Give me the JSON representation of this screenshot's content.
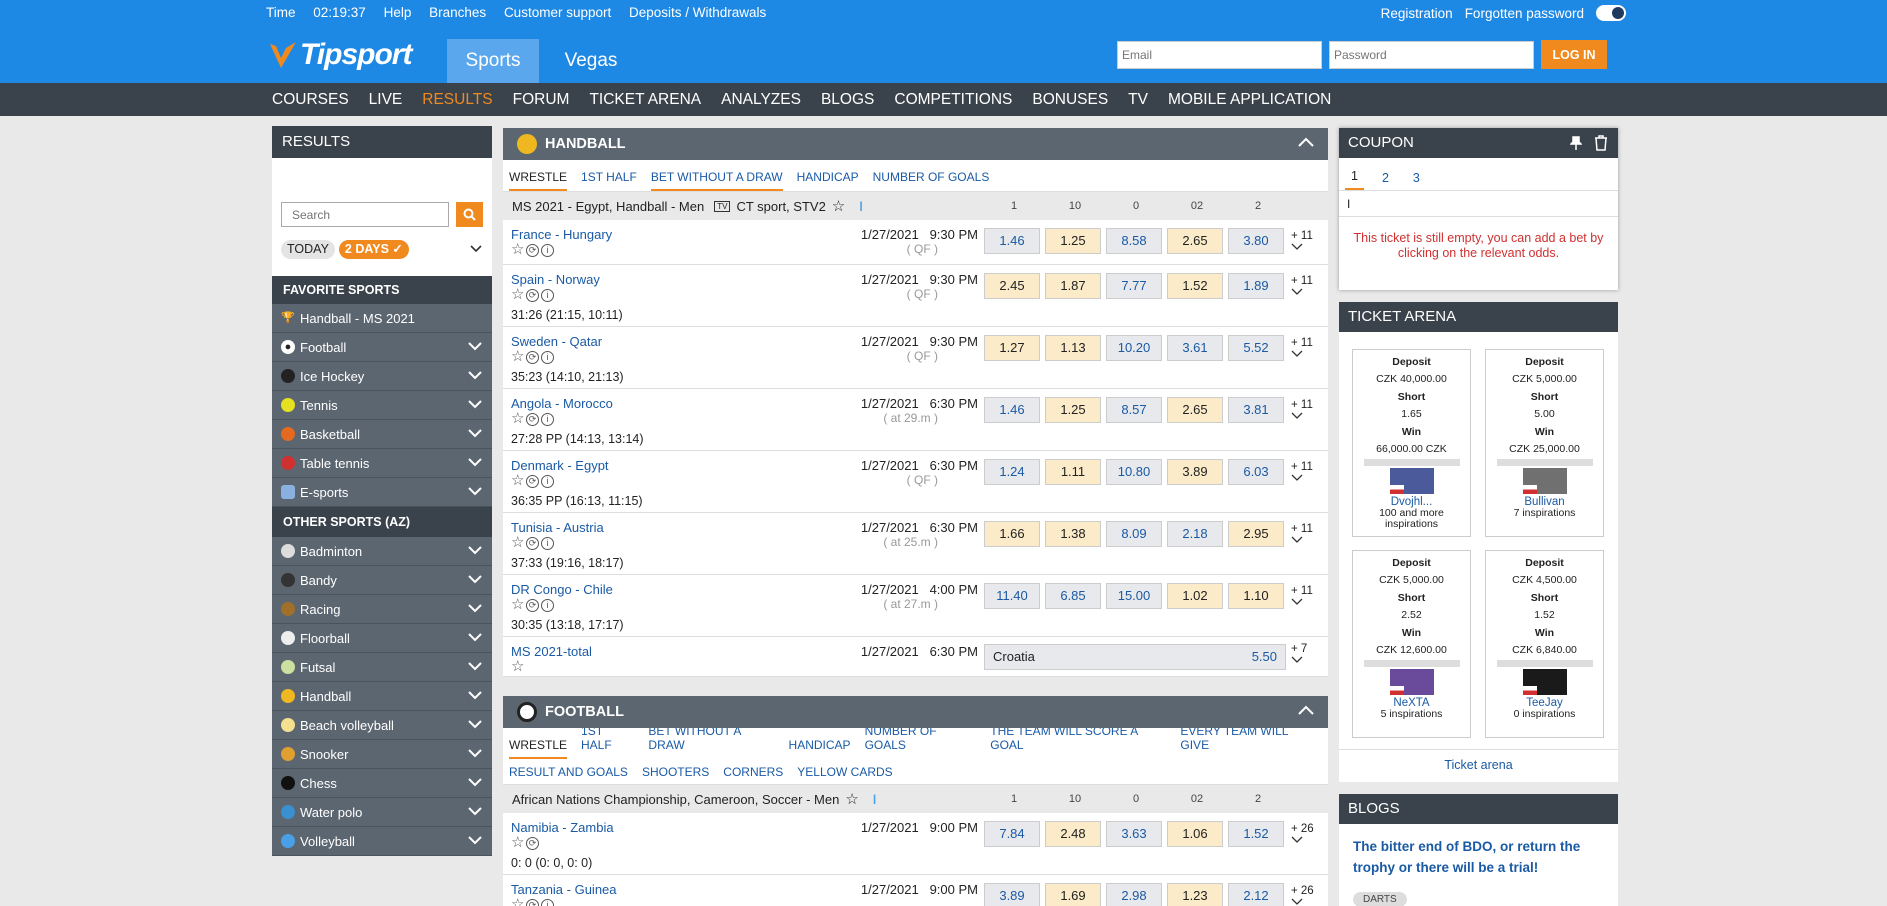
{
  "topbar": {
    "time_label": "Time",
    "time_value": "02:19:37",
    "links": [
      "Help",
      "Branches",
      "Customer support",
      "Deposits / Withdrawals"
    ],
    "registration": "Registration",
    "forgotten_password": "Forgotten password"
  },
  "brand": {
    "logo": "Tipsport",
    "accent": "#f0891e",
    "blue": "#1e88e5"
  },
  "header": {
    "tabs": [
      "Sports",
      "Vegas"
    ],
    "email_placeholder": "Email",
    "password_placeholder": "Password",
    "login_label": "LOG IN"
  },
  "nav": {
    "items": [
      "COURSES",
      "LIVE",
      "RESULTS",
      "FORUM",
      "TICKET ARENA",
      "ANALYZES",
      "BLOGS",
      "COMPETITIONS",
      "BONUSES",
      "TV",
      "MOBILE APPLICATION"
    ],
    "active": "RESULTS"
  },
  "left": {
    "title": "RESULTS",
    "search_placeholder": "Search",
    "chip_today": "TODAY",
    "chip_days": "2 DAYS",
    "favorite_title": "FAVORITE SPORTS",
    "favorites": [
      "Handball - MS 2021",
      "Football",
      "Ice Hockey",
      "Tennis",
      "Basketball",
      "Table tennis",
      "E-sports"
    ],
    "other_title": "OTHER SPORTS (AZ)",
    "others": [
      "Badminton",
      "Bandy",
      "Racing",
      "Floorball",
      "Futsal",
      "Handball",
      "Beach volleyball",
      "Snooker",
      "Chess",
      "Water polo",
      "Volleyball"
    ]
  },
  "handball": {
    "title": "HANDBALL",
    "tabs": [
      "WRESTLE",
      "1ST HALF",
      "BET WITHOUT A DRAW",
      "HANDICAP",
      "NUMBER OF GOALS"
    ],
    "league": "MS 2021 - Egypt, Handball - Men",
    "tv": "CT sport, STV2",
    "odds_headers": [
      "1",
      "10",
      "0",
      "02",
      "2"
    ],
    "matches": [
      {
        "name": "France - Hungary",
        "date": "1/27/2021",
        "time": "9:30 PM",
        "stage": "( QF )",
        "score": "",
        "odds": [
          "1.46",
          "1.25",
          "8.58",
          "2.65",
          "3.80"
        ],
        "more": "+ 11"
      },
      {
        "name": "Spain - Norway",
        "date": "1/27/2021",
        "time": "9:30 PM",
        "stage": "( QF )",
        "score": "31:26 (21:15, 10:11)",
        "odds": [
          "2.45",
          "1.87",
          "7.77",
          "1.52",
          "1.89"
        ],
        "more": "+ 11"
      },
      {
        "name": "Sweden - Qatar",
        "date": "1/27/2021",
        "time": "9:30 PM",
        "stage": "( QF )",
        "score": "35:23 (14:10, 21:13)",
        "odds": [
          "1.27",
          "1.13",
          "10.20",
          "3.61",
          "5.52"
        ],
        "more": "+ 11"
      },
      {
        "name": "Angola - Morocco",
        "date": "1/27/2021",
        "time": "6:30 PM",
        "stage": "( at 29.m )",
        "score": "27:28 PP (14:13, 13:14)",
        "odds": [
          "1.46",
          "1.25",
          "8.57",
          "2.65",
          "3.81"
        ],
        "more": "+ 11"
      },
      {
        "name": "Denmark - Egypt",
        "date": "1/27/2021",
        "time": "6:30 PM",
        "stage": "( QF )",
        "score": "36:35 PP (16:13, 11:15)",
        "odds": [
          "1.24",
          "1.11",
          "10.80",
          "3.89",
          "6.03"
        ],
        "more": "+ 11"
      },
      {
        "name": "Tunisia - Austria",
        "date": "1/27/2021",
        "time": "6:30 PM",
        "stage": "( at 25.m )",
        "score": "37:33 (19:16, 18:17)",
        "odds": [
          "1.66",
          "1.38",
          "8.09",
          "2.18",
          "2.95"
        ],
        "more": "+ 11"
      },
      {
        "name": "DR Congo - Chile",
        "date": "1/27/2021",
        "time": "4:00 PM",
        "stage": "( at 27.m )",
        "score": "30:35 (13:18, 17:17)",
        "odds": [
          "11.40",
          "6.85",
          "15.00",
          "1.02",
          "1.10"
        ],
        "more": "+ 11"
      }
    ],
    "total": {
      "name": "MS 2021-total",
      "date": "1/27/2021",
      "time": "6:30 PM",
      "pick": "Croatia",
      "odd": "5.50",
      "more": "+ 7"
    }
  },
  "football": {
    "title": "FOOTBALL",
    "tabs": [
      "WRESTLE",
      "1ST HALF",
      "BET WITHOUT A DRAW",
      "HANDICAP",
      "NUMBER OF GOALS",
      "THE TEAM WILL SCORE A GOAL",
      "EVERY TEAM WILL GIVE"
    ],
    "tabs2": [
      "RESULT AND GOALS",
      "SHOOTERS",
      "CORNERS",
      "YELLOW CARDS"
    ],
    "league": "African Nations Championship, Cameroon, Soccer - Men",
    "odds_headers": [
      "1",
      "10",
      "0",
      "02",
      "2"
    ],
    "matches": [
      {
        "name": "Namibia - Zambia",
        "date": "1/27/2021",
        "time": "9:00 PM",
        "score": "0: 0 (0: 0, 0: 0)",
        "odds": [
          "7.84",
          "2.48",
          "3.63",
          "1.06",
          "1.52"
        ],
        "more": "+ 26"
      },
      {
        "name": "Tanzania - Guinea",
        "date": "1/27/2021",
        "time": "9:00 PM",
        "score": "",
        "odds": [
          "3.89",
          "1.69",
          "2.98",
          "1.23",
          "2.12"
        ],
        "more": "+ 26"
      }
    ]
  },
  "coupon": {
    "title": "COUPON",
    "tabs": [
      "1",
      "2",
      "3"
    ],
    "cursor": "I",
    "empty_text": "This ticket is still empty, you can add a bet by clicking on the relevant odds."
  },
  "ticket_arena": {
    "title": "TICKET ARENA",
    "labels": {
      "deposit": "Deposit",
      "short": "Short",
      "win": "Win"
    },
    "cards": [
      {
        "deposit": "CZK 40,000.00",
        "short": "1.65",
        "win": "66,000.00 CZK",
        "user": "Dvojhl...",
        "inspirations": "100 and more inspirations"
      },
      {
        "deposit": "CZK 5,000.00",
        "short": "5.00",
        "win": "CZK 25,000.00",
        "user": "Bullivan",
        "inspirations": "7 inspirations"
      },
      {
        "deposit": "CZK 5,000.00",
        "short": "2.52",
        "win": "CZK 12,600.00",
        "user": "NeXTA",
        "inspirations": "5 inspirations"
      },
      {
        "deposit": "CZK 4,500.00",
        "short": "1.52",
        "win": "CZK 6,840.00",
        "user": "TeeJay",
        "inspirations": "0 inspirations"
      }
    ],
    "link": "Ticket arena"
  },
  "blogs": {
    "title": "BLOGS",
    "post_title": "The bitter end of BDO, or return the trophy or there will be a trial!",
    "tag": "DARTS"
  }
}
